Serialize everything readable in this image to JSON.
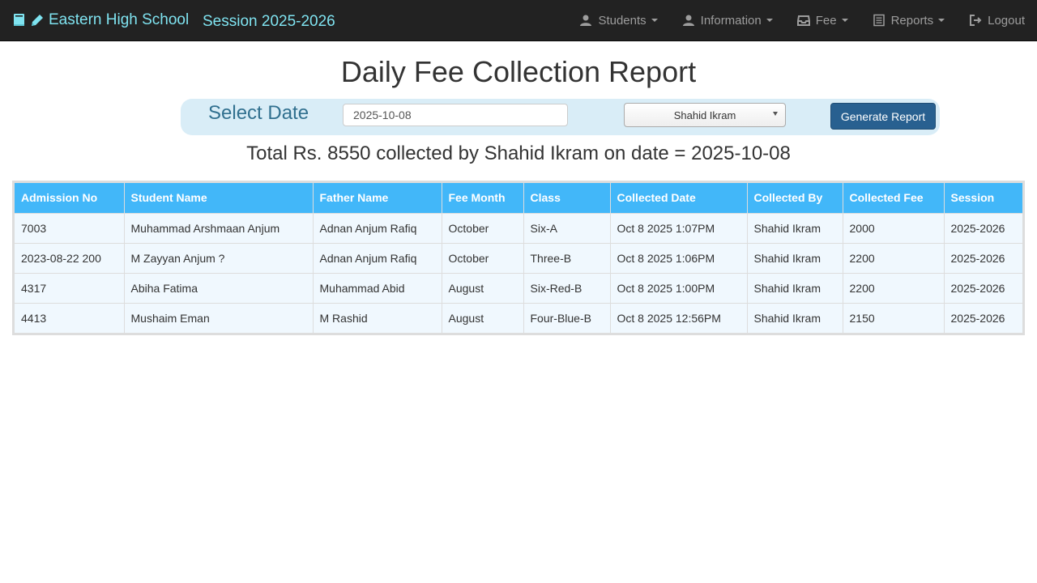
{
  "navbar": {
    "school_name": "Eastern High School",
    "session": "Session 2025-2026",
    "menu": [
      {
        "label": "Students",
        "icon": "user-icon"
      },
      {
        "label": "Information",
        "icon": "user-icon"
      },
      {
        "label": "Fee",
        "icon": "inbox-icon"
      },
      {
        "label": "Reports",
        "icon": "list-icon"
      },
      {
        "label": "Logout",
        "icon": "logout-icon"
      }
    ]
  },
  "page": {
    "title": "Daily Fee Collection Report"
  },
  "filter": {
    "label": "Select Date",
    "date_value": "2025-10-08",
    "collector_selected": "Shahid Ikram",
    "button_label": "Generate Report"
  },
  "summary": "Total Rs. 8550 collected by Shahid Ikram on date = 2025-10-08",
  "table": {
    "columns": [
      "Admission No",
      "Student Name",
      "Father Name",
      "Fee Month",
      "Class",
      "Collected Date",
      "Collected By",
      "Collected Fee",
      "Session"
    ],
    "rows": [
      [
        "7003",
        "Muhammad Arshmaan Anjum",
        "Adnan Anjum Rafiq",
        "October",
        "Six-A",
        "Oct 8 2025 1:07PM",
        "Shahid Ikram",
        "2000",
        "2025-2026"
      ],
      [
        "2023-08-22 200",
        "M Zayyan Anjum ?",
        "Adnan Anjum Rafiq",
        "October",
        "Three-B",
        "Oct 8 2025 1:06PM",
        "Shahid Ikram",
        "2200",
        "2025-2026"
      ],
      [
        "4317",
        "Abiha Fatima",
        "Muhammad Abid",
        "August",
        "Six-Red-B",
        "Oct 8 2025 1:00PM",
        "Shahid Ikram",
        "2200",
        "2025-2026"
      ],
      [
        "4413",
        "Mushaim Eman",
        "M Rashid",
        "August",
        "Four-Blue-B",
        "Oct 8 2025 12:56PM",
        "Shahid Ikram",
        "2150",
        "2025-2026"
      ]
    ]
  },
  "colors": {
    "navbar_bg": "#222222",
    "brand_text": "#7fe3f0",
    "table_header_bg": "#42b7f9",
    "primary_button": "#286090",
    "date_bar_bg": "#d9edf7"
  }
}
